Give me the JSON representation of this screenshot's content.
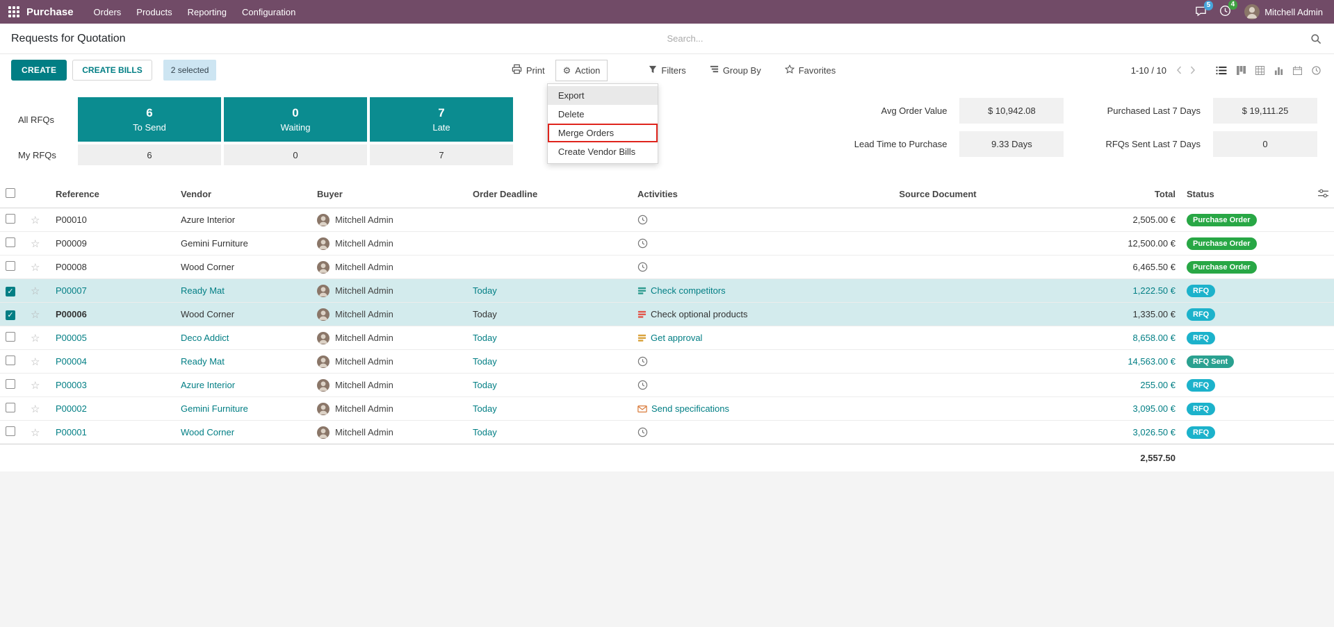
{
  "navbar": {
    "app_name": "Purchase",
    "menus": [
      "Orders",
      "Products",
      "Reporting",
      "Configuration"
    ],
    "messages_badge": "5",
    "activities_badge": "4",
    "user_name": "Mitchell Admin"
  },
  "breadcrumb": {
    "title": "Requests for Quotation"
  },
  "search": {
    "placeholder": "Search..."
  },
  "buttons": {
    "create": "CREATE",
    "create_bills": "CREATE BILLS",
    "selected_count": "2 selected",
    "print": "Print",
    "action": "Action",
    "filters": "Filters",
    "group_by": "Group By",
    "favorites": "Favorites"
  },
  "pager": {
    "range": "1-10 / 10"
  },
  "views": {
    "active_index": 0,
    "options": [
      "list",
      "kanban",
      "pivot",
      "graph",
      "calendar",
      "clock"
    ]
  },
  "action_menu": [
    {
      "label": "Export",
      "hover": true,
      "highlight": false
    },
    {
      "label": "Delete",
      "hover": false,
      "highlight": false
    },
    {
      "label": "Merge Orders",
      "hover": false,
      "highlight": true
    },
    {
      "label": "Create Vendor Bills",
      "hover": false,
      "highlight": false
    }
  ],
  "dashboard": {
    "row1_label": "All RFQs",
    "row2_label": "My RFQs",
    "tiles": [
      {
        "value": "6",
        "label": "To Send",
        "my_value": "6"
      },
      {
        "value": "0",
        "label": "Waiting",
        "my_value": "0"
      },
      {
        "value": "7",
        "label": "Late",
        "my_value": "7"
      }
    ],
    "kpi_columns": [
      [
        {
          "label": "Avg Order Value",
          "value": "$ 10,942.08"
        },
        {
          "label": "Lead Time to Purchase",
          "value": "9.33 Days"
        }
      ],
      [
        {
          "label": "Purchased Last 7 Days",
          "value": "$ 19,111.25"
        },
        {
          "label": "RFQs Sent Last 7 Days",
          "value": "0"
        }
      ]
    ]
  },
  "table": {
    "headers": {
      "reference": "Reference",
      "vendor": "Vendor",
      "buyer": "Buyer",
      "deadline": "Order Deadline",
      "activities": "Activities",
      "source": "Source Document",
      "total": "Total",
      "status": "Status"
    },
    "rows": [
      {
        "reference": "P00010",
        "vendor": "Azure Interior",
        "buyer": "Mitchell Admin",
        "deadline": "",
        "activity_icon": "clock",
        "activity_color": "#777777",
        "activity_label": "",
        "source": "",
        "total": "2,505.00 €",
        "status": "Purchase Order",
        "status_type": "po",
        "selected": false,
        "accent": false,
        "bold": false
      },
      {
        "reference": "P00009",
        "vendor": "Gemini Furniture",
        "buyer": "Mitchell Admin",
        "deadline": "",
        "activity_icon": "clock",
        "activity_color": "#777777",
        "activity_label": "",
        "source": "",
        "total": "12,500.00 €",
        "status": "Purchase Order",
        "status_type": "po",
        "selected": false,
        "accent": false,
        "bold": false
      },
      {
        "reference": "P00008",
        "vendor": "Wood Corner",
        "buyer": "Mitchell Admin",
        "deadline": "",
        "activity_icon": "clock",
        "activity_color": "#777777",
        "activity_label": "",
        "source": "",
        "total": "6,465.50 €",
        "status": "Purchase Order",
        "status_type": "po",
        "selected": false,
        "accent": false,
        "bold": false
      },
      {
        "reference": "P00007",
        "vendor": "Ready Mat",
        "buyer": "Mitchell Admin",
        "deadline": "Today",
        "activity_icon": "bars",
        "activity_color": "#2E9B8F",
        "activity_label": "Check competitors",
        "source": "",
        "total": "1,222.50 €",
        "status": "RFQ",
        "status_type": "rfq",
        "selected": true,
        "accent": true,
        "bold": false
      },
      {
        "reference": "P00006",
        "vendor": "Wood Corner",
        "buyer": "Mitchell Admin",
        "deadline": "Today",
        "activity_icon": "bars",
        "activity_color": "#E2574C",
        "activity_label": "Check optional products",
        "source": "",
        "total": "1,335.00 €",
        "status": "RFQ",
        "status_type": "rfq",
        "selected": true,
        "accent": false,
        "bold": true
      },
      {
        "reference": "P00005",
        "vendor": "Deco Addict",
        "buyer": "Mitchell Admin",
        "deadline": "Today",
        "activity_icon": "bars",
        "activity_color": "#D9A23B",
        "activity_label": "Get approval",
        "source": "",
        "total": "8,658.00 €",
        "status": "RFQ",
        "status_type": "rfq",
        "selected": false,
        "accent": true,
        "bold": false
      },
      {
        "reference": "P00004",
        "vendor": "Ready Mat",
        "buyer": "Mitchell Admin",
        "deadline": "Today",
        "activity_icon": "clock",
        "activity_color": "#777777",
        "activity_label": "",
        "source": "",
        "total": "14,563.00 €",
        "status": "RFQ Sent",
        "status_type": "rfq_sent",
        "selected": false,
        "accent": true,
        "bold": false
      },
      {
        "reference": "P00003",
        "vendor": "Azure Interior",
        "buyer": "Mitchell Admin",
        "deadline": "Today",
        "activity_icon": "clock",
        "activity_color": "#777777",
        "activity_label": "",
        "source": "",
        "total": "255.00 €",
        "status": "RFQ",
        "status_type": "rfq",
        "selected": false,
        "accent": true,
        "bold": false
      },
      {
        "reference": "P00002",
        "vendor": "Gemini Furniture",
        "buyer": "Mitchell Admin",
        "deadline": "Today",
        "activity_icon": "envelope",
        "activity_color": "#D97B3B",
        "activity_label": "Send specifications",
        "source": "",
        "total": "3,095.00 €",
        "status": "RFQ",
        "status_type": "rfq",
        "selected": false,
        "accent": true,
        "bold": false
      },
      {
        "reference": "P00001",
        "vendor": "Wood Corner",
        "buyer": "Mitchell Admin",
        "deadline": "Today",
        "activity_icon": "clock",
        "activity_color": "#777777",
        "activity_label": "",
        "source": "",
        "total": "3,026.50 €",
        "status": "RFQ",
        "status_type": "rfq",
        "selected": false,
        "accent": true,
        "bold": false
      }
    ],
    "footer_total": "2,557.50"
  }
}
